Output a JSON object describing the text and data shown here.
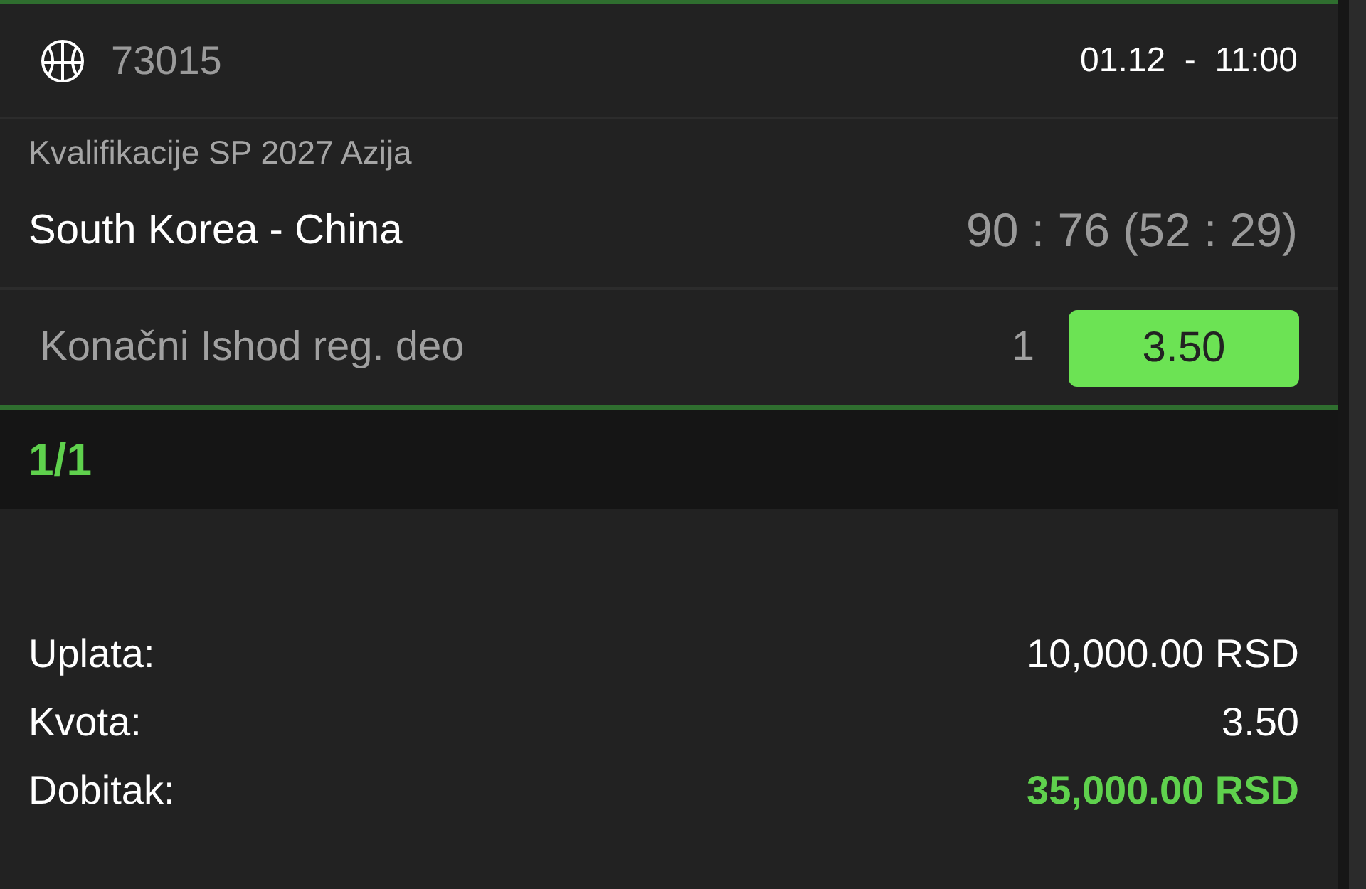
{
  "ticket": {
    "event_code": "73015",
    "datetime": "01.12  -  11:00",
    "league": "Kvalifikacije SP 2027 Azija",
    "match": "South Korea - China",
    "score": "90 : 76 (52 : 29)",
    "market": {
      "name": "Konačni Ishod reg. deo",
      "pick": "1",
      "odds": "3.50",
      "selected": true
    }
  },
  "combination": "1/1",
  "summary": [
    {
      "label": "Uplata:",
      "value": "10,000.00 RSD",
      "highlight": false
    },
    {
      "label": "Kvota:",
      "value": "3.50",
      "highlight": false
    },
    {
      "label": "Dobitak:",
      "value": "35,000.00 RSD",
      "highlight": true
    }
  ]
}
